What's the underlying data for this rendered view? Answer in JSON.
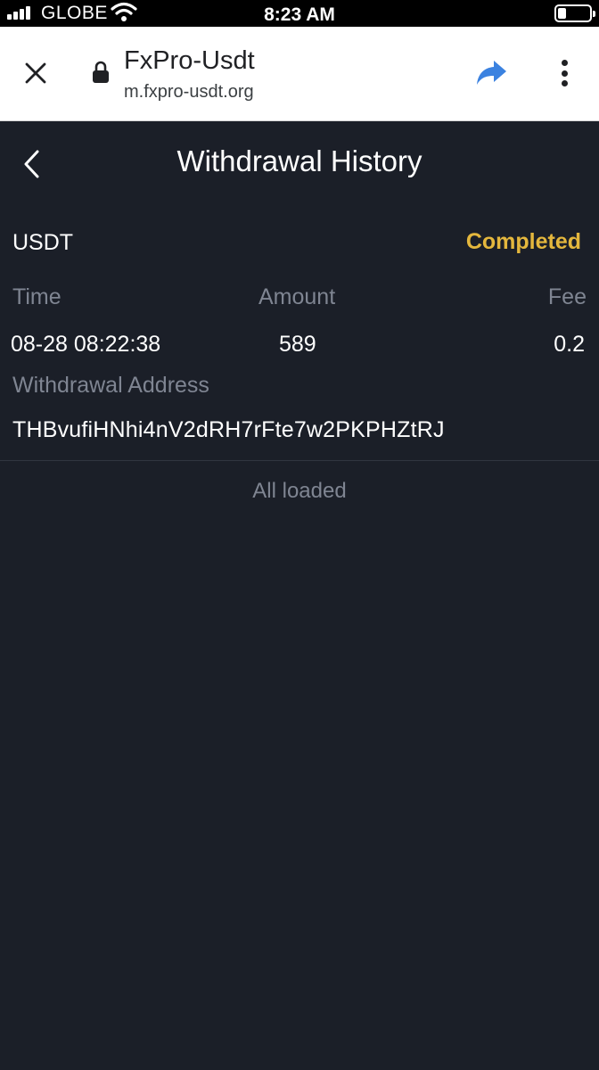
{
  "status_bar": {
    "carrier": "GLOBE",
    "time": "8:23 AM"
  },
  "browser": {
    "title": "FxPro-Usdt",
    "url": "m.fxpro-usdt.org",
    "icons": [
      "close-icon",
      "lock-icon",
      "share-icon",
      "more-vert-icon"
    ],
    "accent_color": "#3b82e0"
  },
  "page": {
    "title": "Withdrawal History"
  },
  "record": {
    "coin": "USDT",
    "status": "Completed",
    "status_color": "#e4b73d",
    "time_label": "Time",
    "amount_label": "Amount",
    "fee_label": "Fee",
    "time": "08-28 08:22:38",
    "amount": "589",
    "fee": "0.2",
    "address_label": "Withdrawal Address",
    "address": "THBvufiHNhi4nV2dRH7rFte7w2PKPHZtRJ"
  },
  "footer": {
    "all_loaded": "All loaded"
  }
}
